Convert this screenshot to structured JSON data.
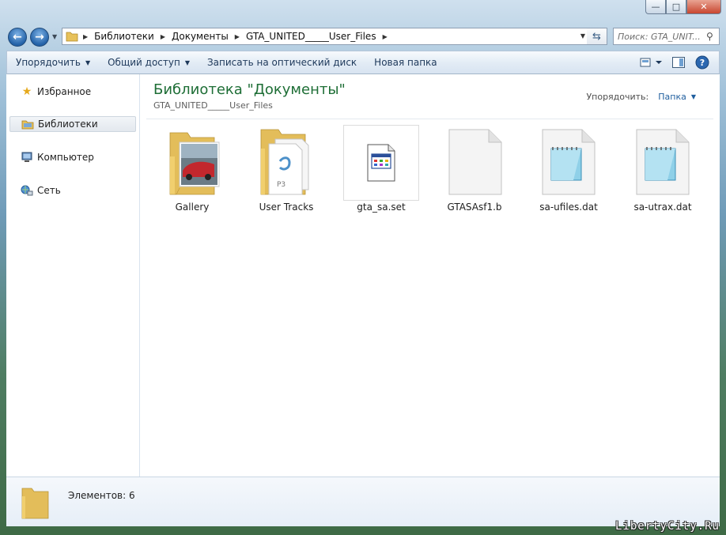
{
  "address": {
    "crumbs": [
      "Библиотеки",
      "Документы",
      "GTA_UNITED_____User_Files"
    ]
  },
  "search": {
    "placeholder": "Поиск: GTA_UNIT..."
  },
  "toolbar": {
    "organize": "Упорядочить",
    "share": "Общий доступ",
    "burn": "Записать на оптический диск",
    "new_folder": "Новая папка"
  },
  "nav": {
    "favorites": "Избранное",
    "libraries": "Библиотеки",
    "computer": "Компьютер",
    "network": "Сеть"
  },
  "library": {
    "title": "Библиотека \"Документы\"",
    "subtitle": "GTA_UNITED_____User_Files",
    "arrange_label": "Упорядочить:",
    "arrange_value": "Папка"
  },
  "files": [
    {
      "name": "Gallery",
      "kind": "folder-photos"
    },
    {
      "name": "User Tracks",
      "kind": "folder-docs"
    },
    {
      "name": "gta_sa.set",
      "kind": "app-file"
    },
    {
      "name": "GTASAsf1.b",
      "kind": "blank-file"
    },
    {
      "name": "sa-ufiles.dat",
      "kind": "notepad-file"
    },
    {
      "name": "sa-utrax.dat",
      "kind": "notepad-file"
    }
  ],
  "status": {
    "count_text": "Элементов: 6"
  },
  "watermark": "LibertyCity.Ru",
  "colors": {
    "accent": "#1e6e36",
    "link": "#1f5e9e"
  }
}
